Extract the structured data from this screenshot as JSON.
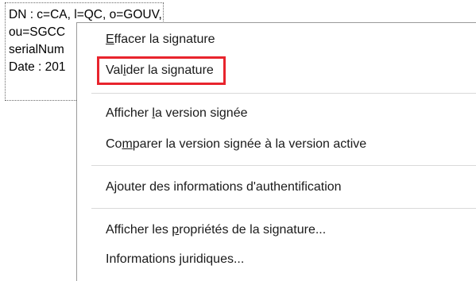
{
  "signature_field": {
    "lines": [
      "DN : c=CA, l=QC, o=GOUV, ou=ICP,",
      "ou=SGCC",
      "serialNum",
      "Date : 201"
    ]
  },
  "context_menu": {
    "items": [
      {
        "before": "",
        "mnemonic": "E",
        "after": "ffacer la signature"
      },
      {
        "before": "Val",
        "mnemonic": "i",
        "after": "der la signature"
      },
      {
        "before": "Afficher ",
        "mnemonic": "l",
        "after": "a version signée"
      },
      {
        "before": "Co",
        "mnemonic": "m",
        "after": "parer la version signée à la version active"
      },
      {
        "before": "",
        "mnemonic": "",
        "after": "Ajouter des informations d'authentification"
      },
      {
        "before": "Afficher les ",
        "mnemonic": "p",
        "after": "ropriétés de la signature..."
      },
      {
        "before": "Informations ",
        "mnemonic": "j",
        "after": "uridiques..."
      }
    ]
  },
  "highlight_color": "#e8242d"
}
